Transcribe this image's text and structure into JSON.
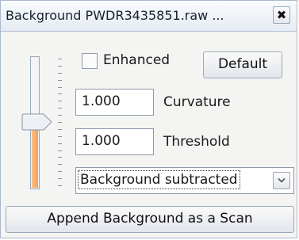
{
  "window": {
    "title": "Background PWDR3435851.raw ...",
    "close_glyph": "✖"
  },
  "controls": {
    "enhanced": {
      "label": "Enhanced",
      "checked": false
    },
    "default_button": "Default",
    "curvature": {
      "value": "1.000",
      "label": "Curvature"
    },
    "threshold": {
      "value": "1.000",
      "label": "Threshold"
    },
    "mode_select": {
      "value": "Background subtracted"
    },
    "append_button": "Append Background as a Scan"
  },
  "slider": {
    "level": 0.5,
    "fill_color": "#f2a15a"
  }
}
